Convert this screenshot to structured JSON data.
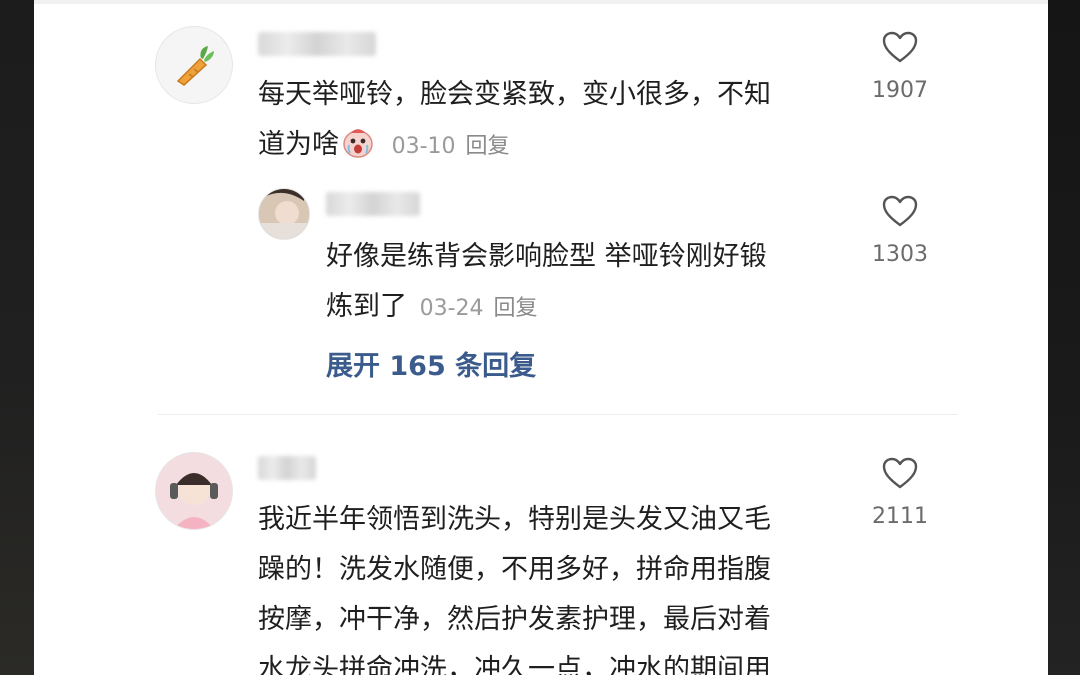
{
  "comments": [
    {
      "text_lines": [
        "每天举哑铃，脸会变紧致，变小很多，不知",
        "道为啥"
      ],
      "date": "03-10",
      "reply_label": "回复",
      "likes": "1907",
      "emoji": "crying-face-emoji"
    },
    {
      "text_lines": [
        "我近半年领悟到洗头，特别是头发又油又毛",
        "躁的！洗发水随便，不用多好，拼命用指腹",
        "按摩，冲干净，然后护发素护理，最后对着",
        "水龙头拼命冲洗，冲久一点，冲水的期间用"
      ],
      "likes": "2111"
    }
  ],
  "reply": {
    "text_lines": [
      "好像是练背会影响脸型 举哑铃刚好锻",
      "炼到了"
    ],
    "date": "03-24",
    "reply_label": "回复",
    "likes": "1303"
  },
  "expand_label": "展开 165 条回复",
  "icons": {
    "like": "heart-outline-icon",
    "avatar1": "carrot-icon"
  },
  "colors": {
    "link_blue": "#3a5b8c",
    "meta_gray": "#9a9a9a"
  }
}
